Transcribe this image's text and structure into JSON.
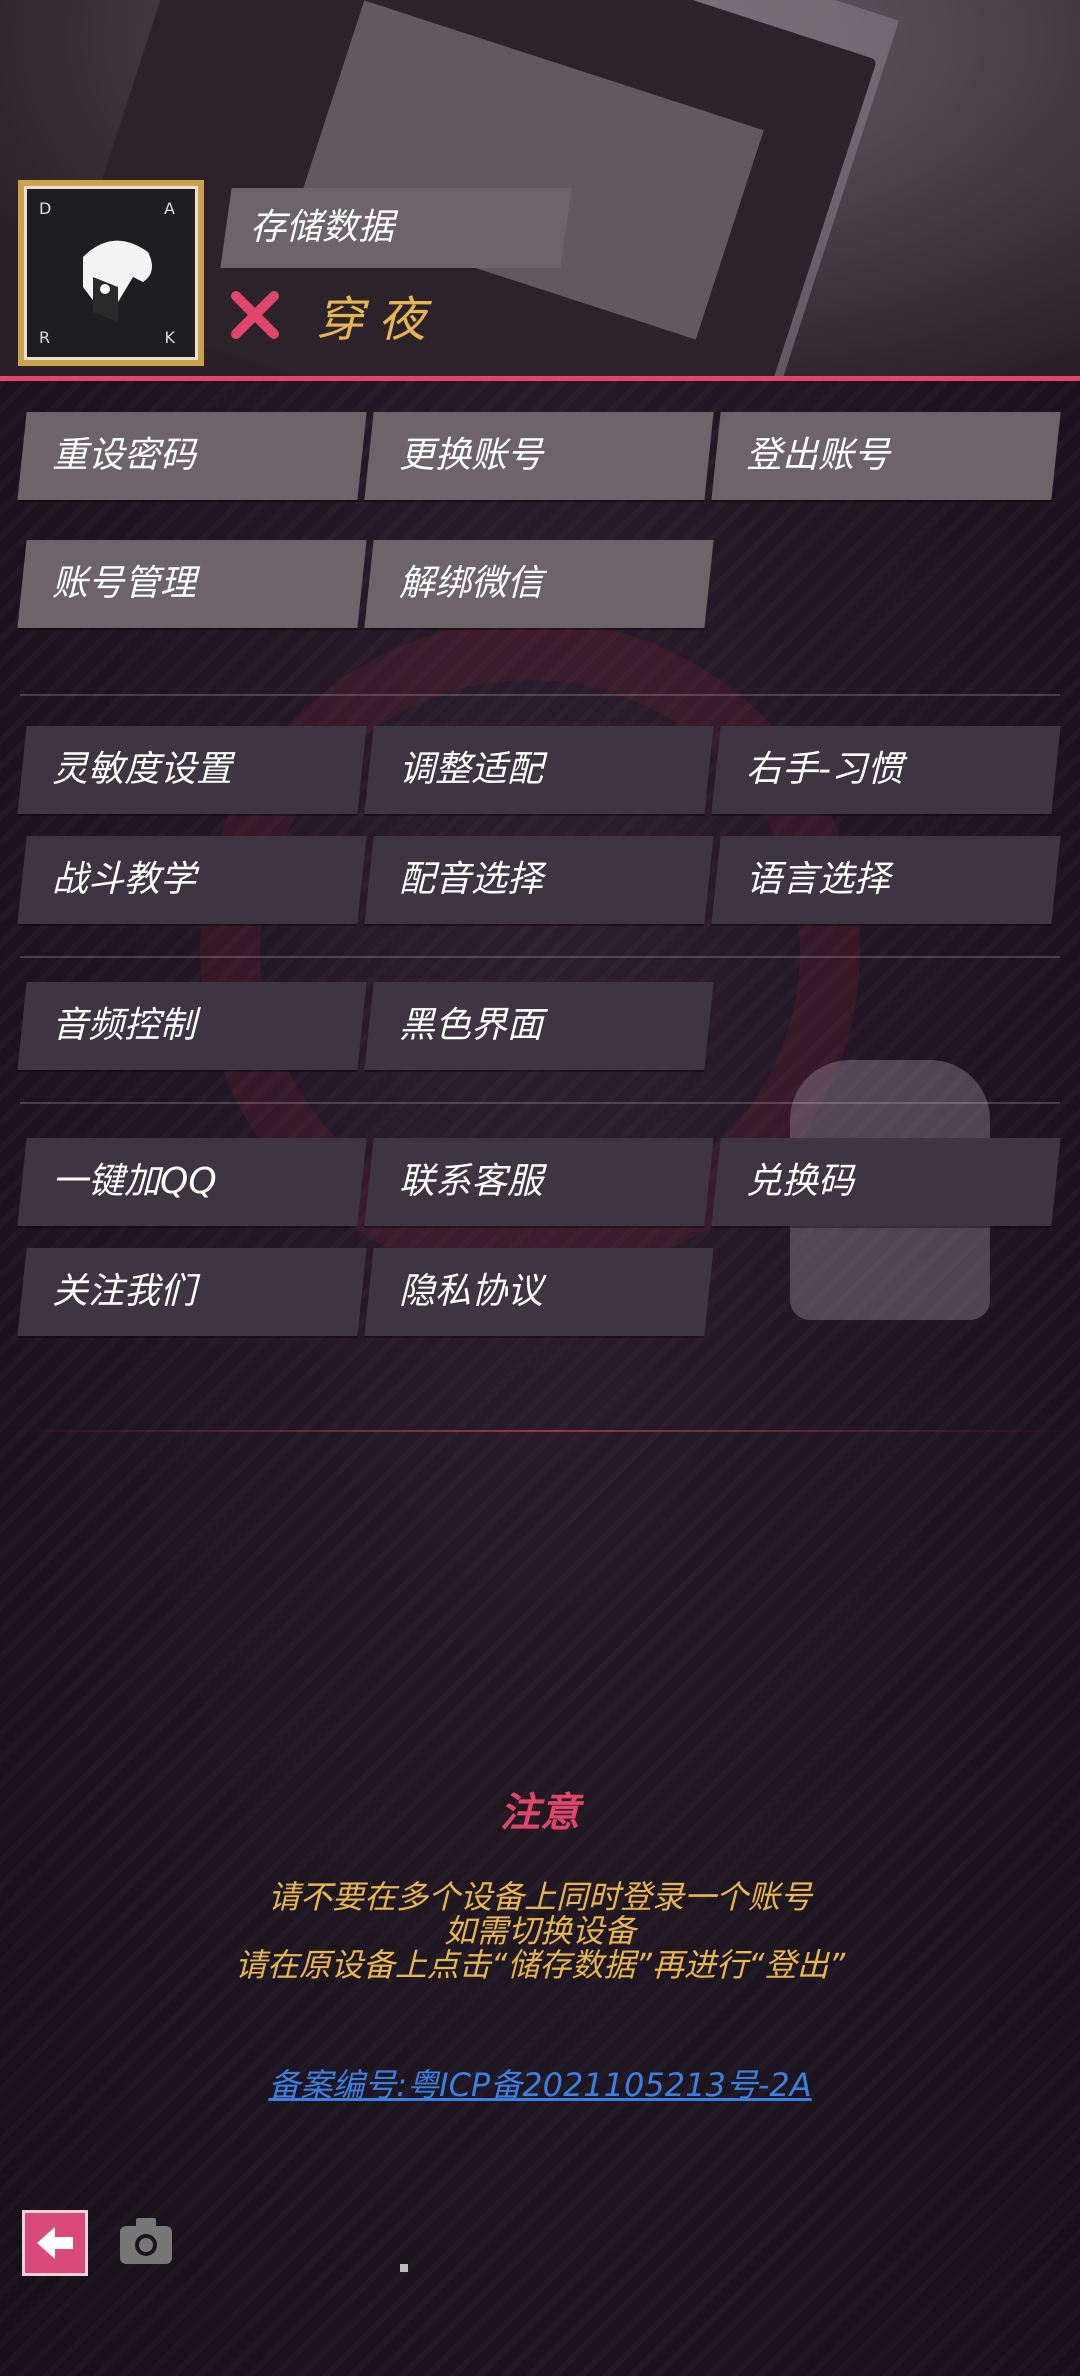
{
  "header": {
    "save_label": "存储数据",
    "username": "穿夜",
    "avatar_corners": [
      "D",
      "A",
      "R",
      "K"
    ]
  },
  "groups": [
    [
      "重设密码",
      "更换账号",
      "登出账号",
      "账号管理",
      "解绑微信"
    ],
    [
      "灵敏度设置",
      "调整适配",
      "右手-习惯",
      "战斗教学",
      "配音选择",
      "语言选择"
    ],
    [
      "音频控制",
      "黑色界面"
    ],
    [
      "一键加QQ",
      "联系客服",
      "兑换码",
      "关注我们",
      "隐私协议"
    ]
  ],
  "notice": {
    "title": "注意",
    "lines": [
      "请不要在多个设备上同时登录一个账号",
      "如需切换设备",
      "请在原设备上点击“储存数据”再进行“登出”"
    ]
  },
  "icp": "备案编号:粤ICP备2021105213号-2A",
  "icons": {
    "back": "arrow-left-icon",
    "camera": "camera-icon",
    "close": "x-mark-icon"
  },
  "colors": {
    "accent": "#e0456a",
    "gold": "#e8b650",
    "button": "#6d6469",
    "button_dark": "#3d3540",
    "link": "#3d7fe0"
  }
}
